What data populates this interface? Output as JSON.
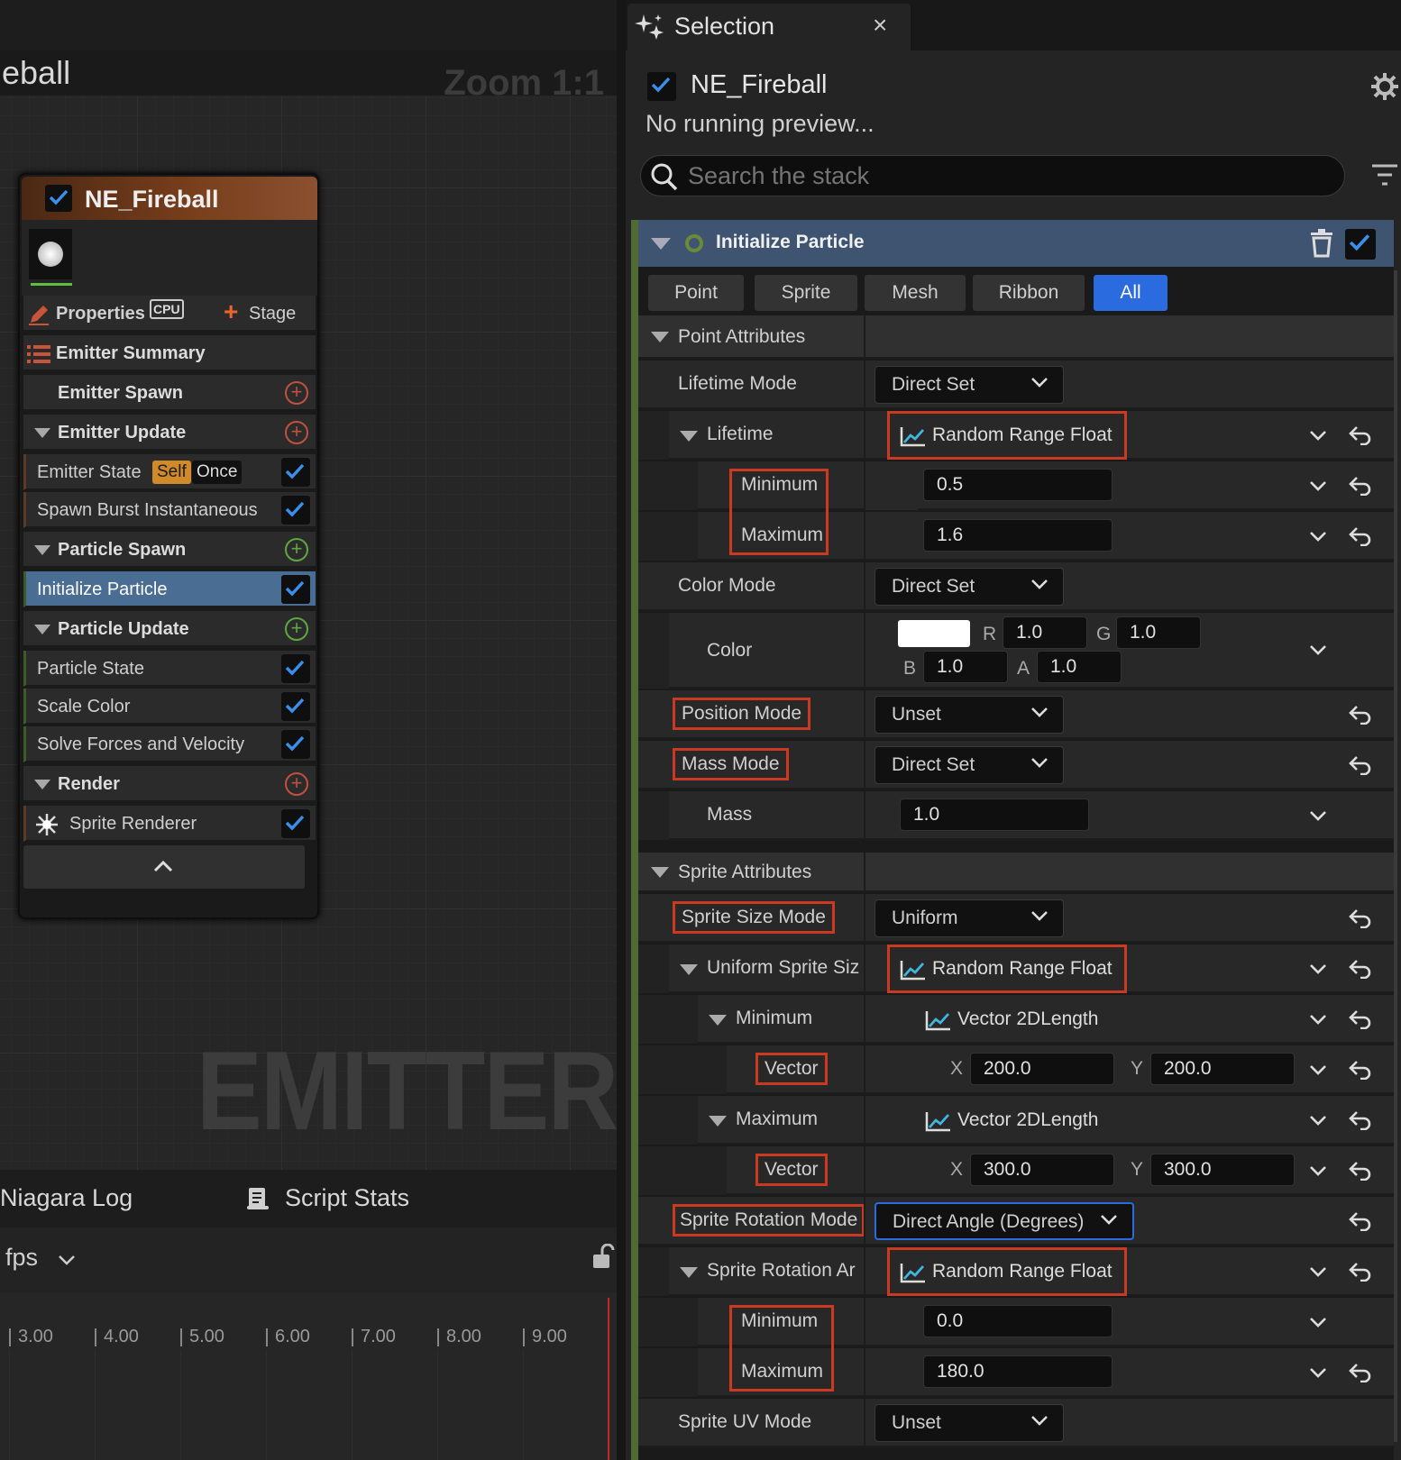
{
  "left": {
    "graph_title": "eball",
    "zoom": "Zoom 1:1",
    "watermark": "EMITTER",
    "node": {
      "title": "NE_Fireball",
      "properties_label": "Properties",
      "cpu_label": "CPU",
      "stage_label": "Stage",
      "rows": [
        {
          "label": "Emitter Summary"
        },
        {
          "label": "Emitter Spawn"
        },
        {
          "label": "Emitter Update"
        },
        {
          "label": "Emitter State"
        },
        {
          "label": "Spawn Burst Instantaneous"
        },
        {
          "label": "Particle Spawn"
        },
        {
          "label": "Initialize Particle"
        },
        {
          "label": "Particle Update"
        },
        {
          "label": "Particle State"
        },
        {
          "label": "Scale Color"
        },
        {
          "label": "Solve Forces and Velocity"
        },
        {
          "label": "Render"
        },
        {
          "label": "Sprite Renderer"
        }
      ],
      "badge_self": "Self",
      "badge_once": "Once"
    },
    "log_tab": "Niagara Log",
    "stats_tab": "Script Stats",
    "fps_label": "fps",
    "timeline_ticks": [
      "3.00",
      "4.00",
      "5.00",
      "6.00",
      "7.00",
      "8.00",
      "9.00"
    ]
  },
  "right": {
    "tab_title": "Selection",
    "tab_close": "×",
    "emitter_name": "NE_Fireball",
    "preview_status": "No running preview...",
    "search_placeholder": "Search the stack",
    "module_title": "Initialize Particle",
    "filter_tabs": [
      "Point",
      "Sprite",
      "Mesh",
      "Ribbon",
      "All"
    ],
    "active_filter": "All",
    "point_attributes": "Point Attributes",
    "lifetime_mode_label": "Lifetime Mode",
    "lifetime_mode_value": "Direct Set",
    "lifetime_label": "Lifetime",
    "lifetime_value": "Random Range Float",
    "lifetime_min_label": "Minimum",
    "lifetime_min": "0.5",
    "lifetime_max_label": "Maximum",
    "lifetime_max": "1.6",
    "color_mode_label": "Color Mode",
    "color_mode_value": "Direct Set",
    "color_label": "Color",
    "color": {
      "r_label": "R",
      "r": "1.0",
      "g_label": "G",
      "g": "1.0",
      "b_label": "B",
      "b": "1.0",
      "a_label": "A",
      "a": "1.0",
      "swatch": "#ffffff"
    },
    "position_mode_label": "Position Mode",
    "position_mode_value": "Unset",
    "mass_mode_label": "Mass Mode",
    "mass_mode_value": "Direct Set",
    "mass_label": "Mass",
    "mass_value": "1.0",
    "sprite_attributes": "Sprite Attributes",
    "sprite_size_mode_label": "Sprite Size Mode",
    "sprite_size_mode_value": "Uniform",
    "uniform_size_label": "Uniform Sprite Siz",
    "uniform_size_value": "Random Range Float",
    "size_min_label": "Minimum",
    "size_min_value": "Vector 2DLength",
    "size_min_vector_label": "Vector",
    "size_min_x": "200.0",
    "size_min_y": "200.0",
    "size_max_label": "Maximum",
    "size_max_value": "Vector 2DLength",
    "size_max_vector_label": "Vector",
    "size_max_x": "300.0",
    "size_max_y": "300.0",
    "x_label": "X",
    "y_label": "Y",
    "rotation_mode_label": "Sprite Rotation Mode",
    "rotation_mode_value": "Direct Angle (Degrees)",
    "rotation_angle_label": "Sprite Rotation Ar",
    "rotation_angle_value": "Random Range Float",
    "rot_min_label": "Minimum",
    "rot_min": "0.0",
    "rot_max_label": "Maximum",
    "rot_max": "180.0",
    "uv_mode_label": "Sprite UV Mode",
    "uv_mode_value": "Unset"
  },
  "colors": {
    "accent": "#2a6ce0",
    "highlight_box": "#c93a22",
    "selected_row": "#4a6d94",
    "module_bar": "#3e5470"
  }
}
